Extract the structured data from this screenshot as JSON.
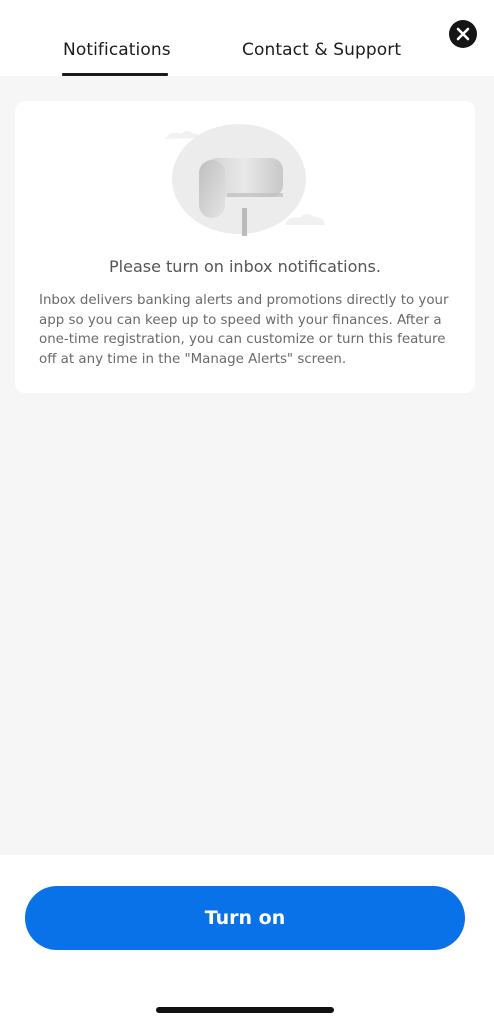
{
  "tabs": [
    {
      "label": "Notifications",
      "selected": true
    },
    {
      "label": "Contact & Support",
      "selected": false
    }
  ],
  "close_icon": "close-icon",
  "card": {
    "illustration_icon": "mailbox-icon",
    "title": "Please turn on inbox notifications.",
    "body": "Inbox delivers banking alerts and promotions directly to your app so you can keep up to speed with your finances. After a one-time registration, you can customize or turn this feature off at any time in the \"Manage Alerts\" screen."
  },
  "footer": {
    "turn_on_label": "Turn on"
  },
  "colors": {
    "accent": "#0a72e8",
    "background": "#f6f6f6",
    "text_primary": "#1c1c1c"
  }
}
